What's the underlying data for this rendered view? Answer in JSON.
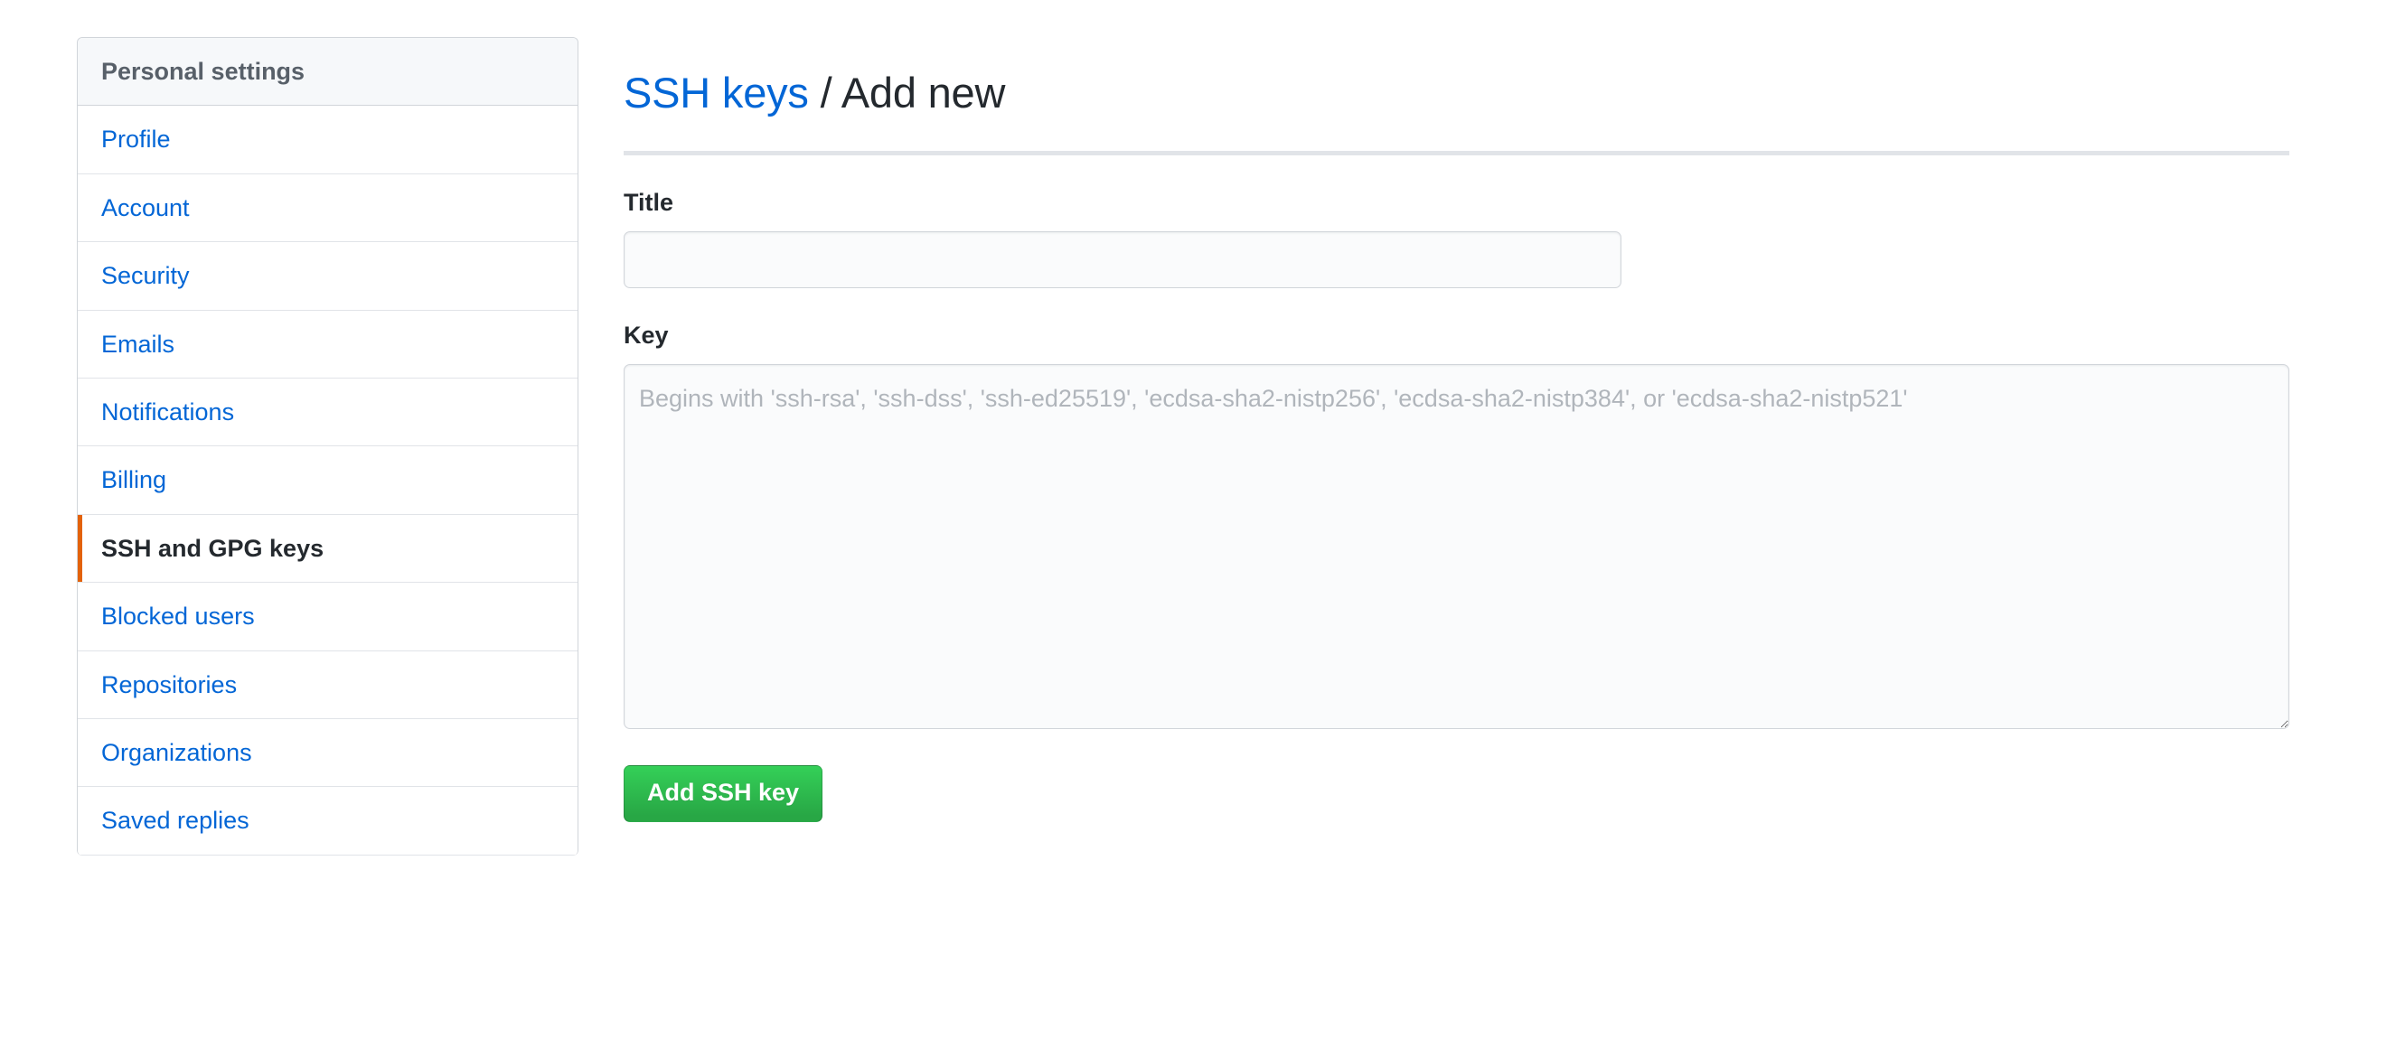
{
  "sidebar": {
    "header": "Personal settings",
    "items": [
      {
        "label": "Profile",
        "selected": false
      },
      {
        "label": "Account",
        "selected": false
      },
      {
        "label": "Security",
        "selected": false
      },
      {
        "label": "Emails",
        "selected": false
      },
      {
        "label": "Notifications",
        "selected": false
      },
      {
        "label": "Billing",
        "selected": false
      },
      {
        "label": "SSH and GPG keys",
        "selected": true
      },
      {
        "label": "Blocked users",
        "selected": false
      },
      {
        "label": "Repositories",
        "selected": false
      },
      {
        "label": "Organizations",
        "selected": false
      },
      {
        "label": "Saved replies",
        "selected": false
      }
    ]
  },
  "main": {
    "breadcrumb_link": "SSH keys",
    "breadcrumb_separator": " / ",
    "breadcrumb_current": "Add new",
    "title_field": {
      "label": "Title",
      "value": "",
      "placeholder": ""
    },
    "key_field": {
      "label": "Key",
      "value": "",
      "placeholder": "Begins with 'ssh-rsa', 'ssh-dss', 'ssh-ed25519', 'ecdsa-sha2-nistp256', 'ecdsa-sha2-nistp384', or 'ecdsa-sha2-nistp521'"
    },
    "submit_label": "Add SSH key"
  },
  "colors": {
    "link": "#0366d6",
    "selected_accent": "#e36209",
    "button_green": "#28a745",
    "border": "#d1d5da",
    "header_bg": "#f6f8fa",
    "input_bg": "#fafbfc"
  }
}
